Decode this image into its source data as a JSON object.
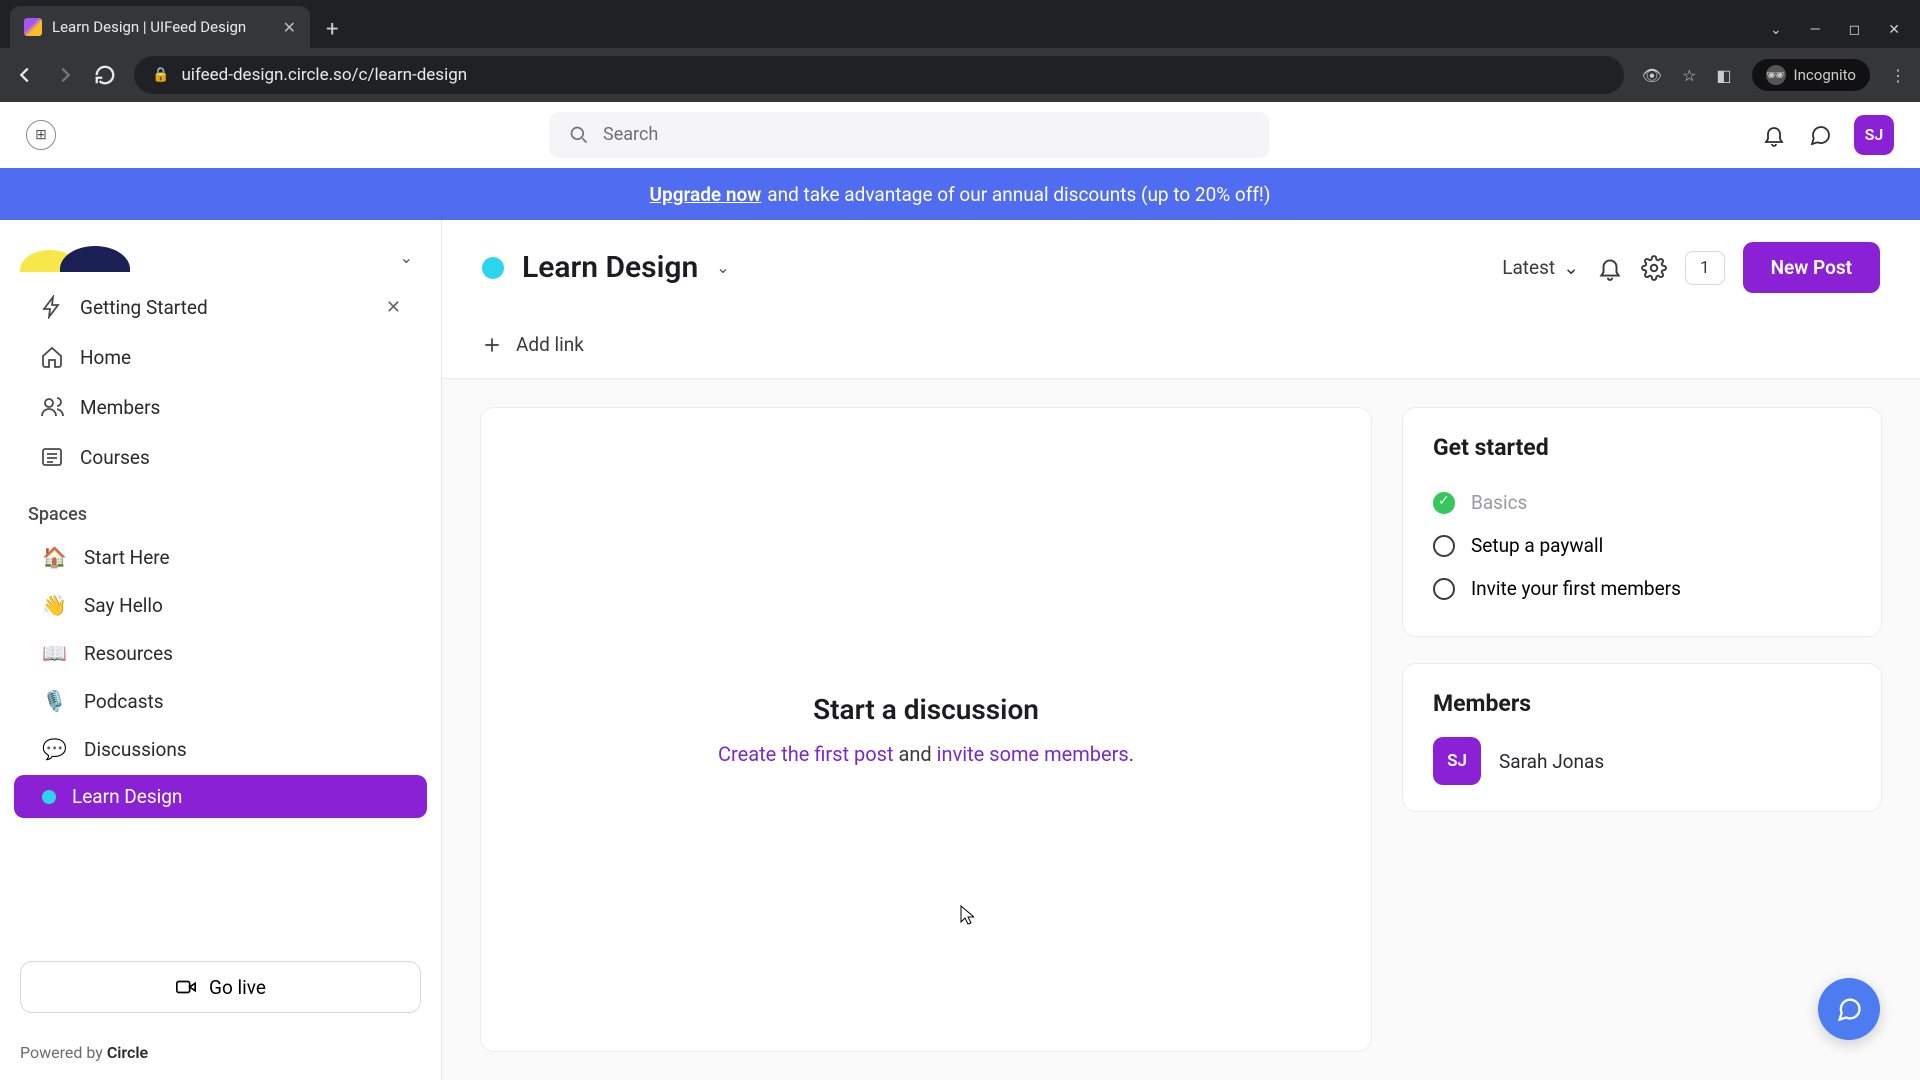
{
  "browser": {
    "tab_title": "Learn Design | UIFeed Design",
    "url": "uifeed-design.circle.so/c/learn-design",
    "incognito_label": "Incognito"
  },
  "topbar": {
    "search_placeholder": "Search",
    "avatar_initials": "SJ"
  },
  "banner": {
    "cta": "Upgrade now",
    "rest": "  and take advantage of our annual discounts (up to 20% off!)"
  },
  "sidebar": {
    "nav": {
      "getting_started": "Getting Started",
      "home": "Home",
      "members": "Members",
      "courses": "Courses"
    },
    "section_label": "Spaces",
    "spaces": [
      {
        "icon": "🏠",
        "label": "Start Here"
      },
      {
        "icon": "👋",
        "label": "Say Hello"
      },
      {
        "icon": "📖",
        "label": "Resources"
      },
      {
        "icon": "🎙️",
        "label": "Podcasts"
      },
      {
        "icon": "💬",
        "label": "Discussions"
      },
      {
        "icon": "dot",
        "label": "Learn Design",
        "active": true
      }
    ],
    "go_live": "Go live",
    "powered_prefix": "Powered by ",
    "powered_brand": "Circle"
  },
  "header": {
    "title": "Learn Design",
    "sort_label": "Latest",
    "count": "1",
    "new_post": "New Post",
    "add_link": "Add link"
  },
  "empty": {
    "title": "Start a discussion",
    "link1": "Create the first post",
    "mid": " and ",
    "link2": "invite some members",
    "tail": "."
  },
  "get_started": {
    "title": "Get started",
    "items": [
      {
        "label": "Basics",
        "done": true
      },
      {
        "label": "Setup a paywall",
        "done": false
      },
      {
        "label": "Invite your first members",
        "done": false
      }
    ]
  },
  "members_panel": {
    "title": "Members",
    "list": [
      {
        "initials": "SJ",
        "name": "Sarah Jonas"
      }
    ]
  },
  "colors": {
    "brand_purple": "#8b21d4",
    "banner_blue": "#506cf0",
    "space_dot": "#2dd4f0",
    "fab_blue": "#4d7cf0",
    "success": "#34c759"
  }
}
